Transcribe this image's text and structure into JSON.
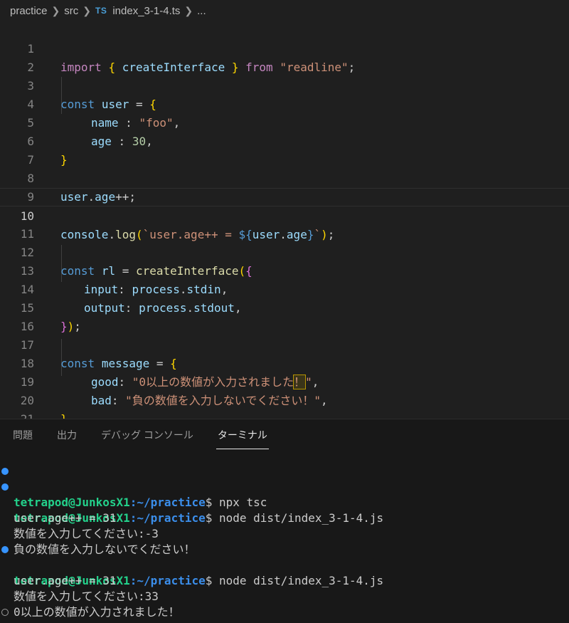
{
  "breadcrumb": {
    "folder1": "practice",
    "folder2": "src",
    "file_badge": "TS",
    "file": "index_3-1-4.ts",
    "more": "..."
  },
  "editor": {
    "current_line": 10,
    "line_numbers": [
      "1",
      "2",
      "3",
      "4",
      "5",
      "6",
      "7",
      "8",
      "9",
      "10",
      "11",
      "12",
      "13",
      "14",
      "15",
      "16",
      "17",
      "18",
      "19",
      "20",
      "21"
    ],
    "code": {
      "l1": [
        "import",
        " ",
        "{",
        " ",
        "createInterface",
        " ",
        "}",
        " ",
        "from",
        " ",
        "\"readline\"",
        ";"
      ],
      "l3": [
        "const",
        " ",
        "user",
        " = ",
        "{"
      ],
      "l4": [
        "name",
        " : ",
        "\"foo\"",
        ","
      ],
      "l5": [
        "age",
        " : ",
        "30",
        ","
      ],
      "l6": [
        "}"
      ],
      "l8": [
        "user",
        ".",
        "age",
        "++;"
      ],
      "l10": [
        "console",
        ".",
        "log",
        "(",
        "`user.age++ = ",
        "${",
        "user",
        ".",
        "age",
        "}",
        "`",
        ")",
        ";"
      ],
      "l12": [
        "const",
        " ",
        "rl",
        " = ",
        "createInterface",
        "(",
        "{"
      ],
      "l13": [
        "input",
        ": ",
        "process",
        ".",
        "stdin",
        ","
      ],
      "l14": [
        "output",
        ": ",
        "process",
        ".",
        "stdout",
        ","
      ],
      "l15": [
        "}",
        ")",
        ";"
      ],
      "l17": [
        "const",
        " ",
        "message",
        " = ",
        "{"
      ],
      "l18": [
        "good",
        ": ",
        "\"0以上の数値が入力されました",
        "！",
        "\"",
        ","
      ],
      "l19": [
        "bad",
        ": ",
        "\"負の数値を入力しないでください！\"",
        ","
      ],
      "l20": [
        "}"
      ]
    }
  },
  "panel": {
    "tabs": [
      "問題",
      "出力",
      "デバッグ コンソール",
      "ターミナル"
    ],
    "active_tab": "ターミナル"
  },
  "terminal": {
    "prompt_user": "tetrapod@JunkosX1",
    "prompt_path": ":~/practice",
    "prompt_suffix": "$ ",
    "lines": [
      {
        "type": "prompt",
        "cmd": "npx tsc"
      },
      {
        "type": "prompt",
        "cmd": "node dist/index_3-1-4.js"
      },
      {
        "type": "out",
        "text": "user.age++ = 31"
      },
      {
        "type": "out",
        "text": "数値を入力してください:-3"
      },
      {
        "type": "out",
        "text": "負の数値を入力しないでください！"
      },
      {
        "type": "prompt",
        "cmd": "node dist/index_3-1-4.js"
      },
      {
        "type": "out",
        "text": "user.age++ = 31"
      },
      {
        "type": "out",
        "text": "数値を入力してください:33"
      },
      {
        "type": "out",
        "text": "0以上の数値が入力されました！"
      },
      {
        "type": "prompt_active",
        "cmd": ""
      }
    ]
  },
  "colors": {
    "background": "#1f1f1f",
    "keyword": "#569cd6",
    "import_keyword": "#c586c0",
    "variable": "#9cdcfe",
    "function": "#dcdcaa",
    "string": "#ce9178",
    "number": "#b5cea8",
    "prompt_user": "#23d18b",
    "prompt_path": "#3b8eea"
  }
}
